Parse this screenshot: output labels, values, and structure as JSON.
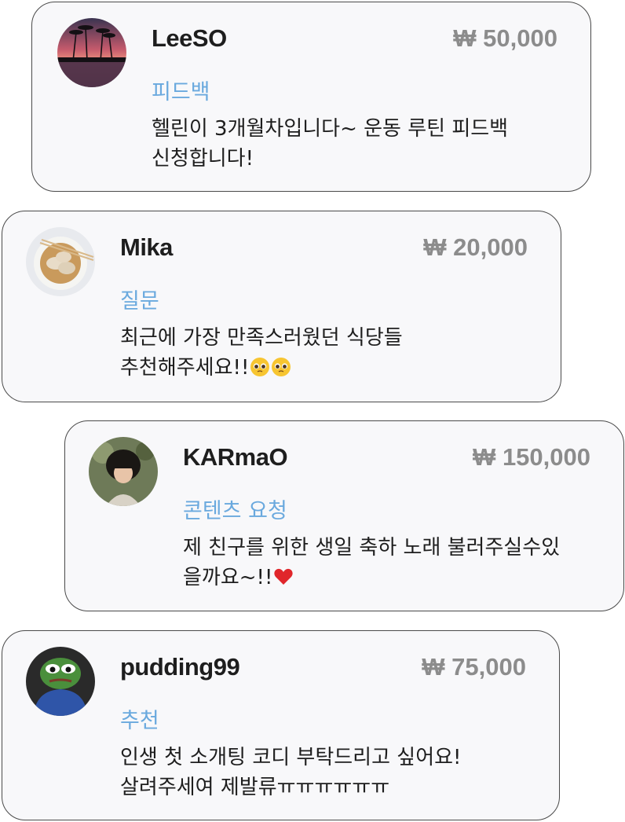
{
  "currency_symbol": "₩",
  "colors": {
    "category": "#6aa9de",
    "amount": "#8c8c8c",
    "card_bg": "#f8f8fa",
    "border": "#4a4a4a"
  },
  "donations": [
    {
      "username": "LeeSO",
      "amount": "50,000",
      "category": "피드백",
      "message": [
        "헬린이 3개월차입니다~  운동 루틴 피드백",
        "신청합니다!"
      ],
      "avatar": "sunset-palm-trees"
    },
    {
      "username": "Mika",
      "amount": "20,000",
      "category": "질문",
      "message": [
        "최근에 가장 만족스러웠던 식당들",
        "추천해주세요!!"
      ],
      "emoji": [
        "pleading-face-emoji",
        "pleading-face-emoji"
      ],
      "avatar": "dumplings-bowl"
    },
    {
      "username": "KARmaO",
      "amount": "150,000",
      "category": "콘텐츠 요청",
      "message": [
        "제 친구를 위한 생일 축하 노래 불러주실수있",
        "을까요~!!"
      ],
      "emoji": [
        "red-heart-emoji"
      ],
      "avatar": "person-portrait"
    },
    {
      "username": "pudding99",
      "amount": "75,000",
      "category": "추천",
      "message": [
        "인생 첫 소개팅 코디 부탁드리고 싶어요!",
        "살려주세여 제발류ㅠㅠㅠㅠㅠㅠ"
      ],
      "avatar": "pepe-frog"
    }
  ]
}
